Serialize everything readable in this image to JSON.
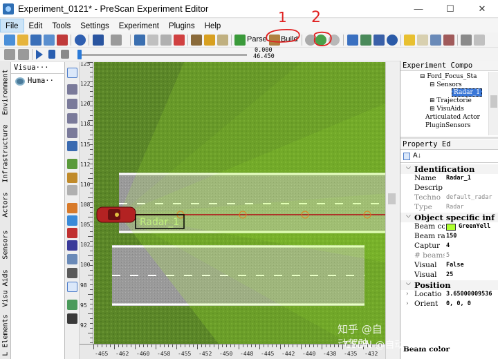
{
  "window": {
    "title": "Experiment_0121* - PreScan Experiment Editor",
    "minimize_glyph": "—",
    "maximize_glyph": "☐",
    "close_glyph": "✕"
  },
  "menu": {
    "items": [
      "File",
      "Edit",
      "Tools",
      "Settings",
      "Experiment",
      "Plugins",
      "Help"
    ],
    "active": "File"
  },
  "toolbar": {
    "parse_label": "Parse",
    "build_label": "Build",
    "time_top": "0.000",
    "time_bottom": "46.450"
  },
  "annotations": {
    "mark_1": "1",
    "mark_2": "2"
  },
  "left_tabs": [
    "Environment",
    "Infrastructure",
    "Actors",
    "Sensors",
    "Visu Aids",
    "L Elements"
  ],
  "visu_panel": {
    "title": "Visua···",
    "item_label": "Huma··"
  },
  "canvas": {
    "bg_color": "#5e8a2a",
    "beam_color": "#adff2f",
    "radar_label": "Radar_1",
    "y_ticks": [
      "125",
      "122",
      "120",
      "118",
      "115",
      "112",
      "110",
      "108",
      "105",
      "102",
      "100",
      "98",
      "95",
      "92"
    ],
    "x_ticks": [
      "-465",
      "-462",
      "-460",
      "-458",
      "-455",
      "-452",
      "-450",
      "-448",
      "-445",
      "-442",
      "-440",
      "-438",
      "-435",
      "-432"
    ]
  },
  "experiment_components": {
    "title": "Experiment Compo",
    "tree": [
      {
        "label": "Ford_Focus_Sta",
        "expander": "⊟"
      },
      {
        "label": "Sensors",
        "expander": "⊟"
      },
      {
        "label": "Radar_1",
        "expander": "",
        "selected": true
      },
      {
        "label": "Trajectorie",
        "expander": "⊞"
      },
      {
        "label": "VisuAids",
        "expander": "⊞"
      },
      {
        "label": "Articulated Actor",
        "expander": ""
      },
      {
        "label": "PluginSensors",
        "expander": ""
      }
    ]
  },
  "property_editor": {
    "title": "Property Ed",
    "sort_label": "A↓",
    "categories": [
      {
        "name": "Identification",
        "rows": [
          {
            "key": "Name",
            "value": "Radar_1",
            "grey": false
          },
          {
            "key": "Descrip",
            "value": "",
            "grey": false
          },
          {
            "key": "Techno",
            "value": "default_radar",
            "grey": true
          },
          {
            "key": "Type",
            "value": "Radar",
            "grey": true
          }
        ]
      },
      {
        "name": "Object specific inf",
        "rows": [
          {
            "key": "Beam co",
            "value": "GreenYell",
            "grey": false,
            "swatch": "#adff2f"
          },
          {
            "key": "Beam ra",
            "value": "150",
            "grey": false
          },
          {
            "key": "Captur",
            "value": "4",
            "grey": false
          },
          {
            "key": "# beams",
            "value": "5",
            "grey": true
          },
          {
            "key": "Visual",
            "value": "False",
            "grey": false
          },
          {
            "key": "Visual",
            "value": "25",
            "grey": false
          }
        ]
      },
      {
        "name": "Position",
        "rows": [
          {
            "key": "Locatio",
            "value": "3.65000009536",
            "grey": false,
            "arrow": true
          },
          {
            "key": "Orient",
            "value": "0, 0, 0",
            "grey": false,
            "arrow": true
          }
        ]
      }
    ],
    "footer": "Beam color"
  },
  "watermarks": {
    "line1": "知乎 @自动驾驶Player",
    "line2": "CSDN @自动驾驶Player"
  }
}
